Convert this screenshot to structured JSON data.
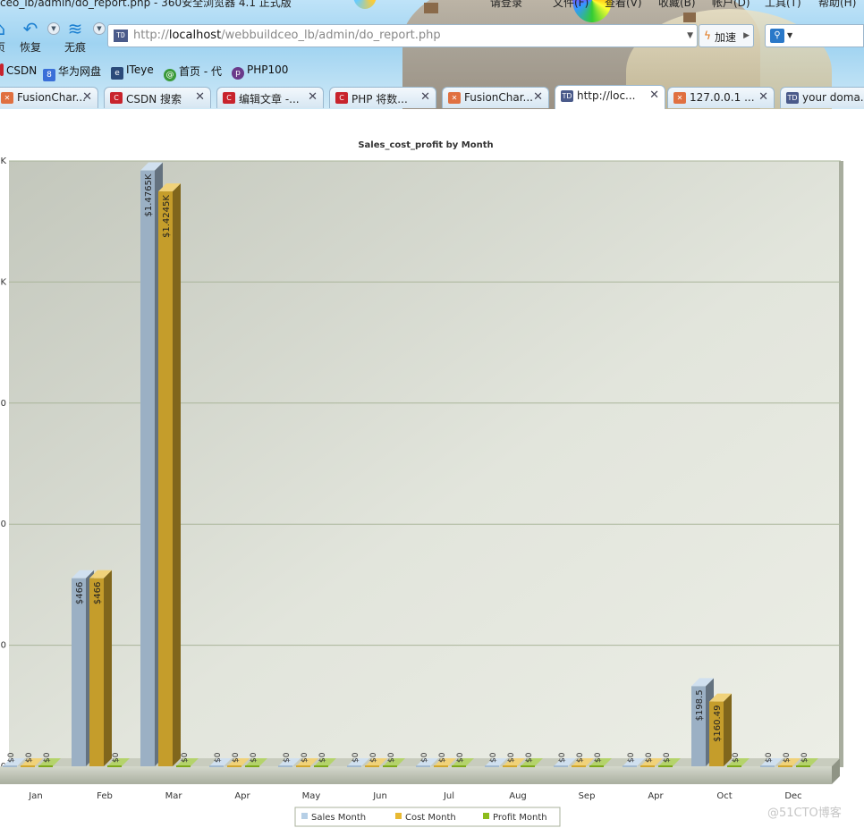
{
  "window": {
    "title_left": "ceo_lb/admin/do_report.php - 360安全浏览器 4.1 正式版",
    "menu": [
      "请登录",
      "文件(F)",
      "查看(V)",
      "收藏(B)",
      "帐户(D)",
      "工具(T)",
      "帮助(H)"
    ]
  },
  "toolbar": {
    "buttons": [
      {
        "icon": "home-icon",
        "label": "页"
      },
      {
        "icon": "restore-icon",
        "label": "恢复"
      },
      {
        "icon": "incognito-icon",
        "label": "无痕"
      }
    ]
  },
  "address": {
    "prefix": "http://",
    "host": "localhost",
    "path": "/webbuildceo_lb/admin/do_report.php",
    "site_icon": "TD",
    "accelerate_label": "加速"
  },
  "favorites": [
    {
      "label": "CSDN",
      "icon": "csdn-icon",
      "color": "#c8232c"
    },
    {
      "label": "华为网盘",
      "icon": "huawei-disk-icon",
      "color": "#3a6fd8"
    },
    {
      "label": "ITeye",
      "icon": "iteye-icon",
      "color": "#2a4a7a"
    },
    {
      "label": "首页 - 代",
      "icon": "site-icon",
      "color": "#3a9a3a"
    },
    {
      "label": "PHP100",
      "icon": "php100-icon",
      "color": "#6a3a8a"
    }
  ],
  "tabs": [
    {
      "label": "FusionChar...",
      "icon": "fusioncharts-icon",
      "color": "#e07040",
      "active": false
    },
    {
      "label": "CSDN 搜索",
      "icon": "csdn-icon",
      "color": "#c8232c",
      "active": false
    },
    {
      "label": "编辑文章 -...",
      "icon": "csdn-icon",
      "color": "#c8232c",
      "active": false
    },
    {
      "label": "PHP 将数...",
      "icon": "csdn-icon",
      "color": "#c8232c",
      "active": false
    },
    {
      "label": "FusionChar...",
      "icon": "fusioncharts-icon",
      "color": "#e07040",
      "active": false
    },
    {
      "label": "http://loc...",
      "icon": "td-icon",
      "color": "#4a5a8a",
      "active": true
    },
    {
      "label": "127.0.0.1 ...",
      "icon": "fusioncharts-icon",
      "color": "#e07040",
      "active": false
    },
    {
      "label": "your doma...",
      "icon": "td-icon",
      "color": "#4a5a8a",
      "active": false
    }
  ],
  "chart_data": {
    "type": "bar",
    "title": "Sales_cost_profit by Month",
    "categories": [
      "Jan",
      "Feb",
      "Mar",
      "Apr",
      "May",
      "Jun",
      "Jul",
      "Aug",
      "Sep",
      "Apr",
      "Oct",
      "Dec"
    ],
    "series": [
      {
        "name": "Sales Month",
        "color": "#b6cfe6",
        "values": [
          0,
          466,
          1476.5,
          0,
          0,
          0,
          0,
          0,
          0,
          0,
          198.5,
          0
        ],
        "labels": [
          "$0",
          "$466",
          "$1.4765K",
          "$0",
          "$0",
          "$0",
          "$0",
          "$0",
          "$0",
          "$0",
          "$198.5",
          "$0"
        ]
      },
      {
        "name": "Cost Month",
        "color": "#e8b932",
        "values": [
          0,
          466,
          1424.5,
          0,
          0,
          0,
          0,
          0,
          0,
          0,
          160.49,
          0
        ],
        "labels": [
          "$0",
          "$466",
          "$1.4245K",
          "$0",
          "$0",
          "$0",
          "$0",
          "$0",
          "$0",
          "$0",
          "$160.49",
          "$0"
        ]
      },
      {
        "name": "Profit Month",
        "color": "#8cbc1c",
        "values": [
          0,
          0,
          0,
          0,
          0,
          0,
          0,
          0,
          0,
          0,
          0,
          0
        ],
        "labels": [
          "$0",
          "$0",
          "$0",
          "$0",
          "$0",
          "$0",
          "$0",
          "$0",
          "$0",
          "$0",
          "$0",
          "$0"
        ]
      }
    ],
    "ylim": [
      0,
      1500
    ],
    "yticks": [
      0,
      300,
      600,
      900,
      1200,
      1500
    ],
    "ytick_labels": [
      "0",
      "0",
      "0",
      "0",
      "K",
      "K"
    ],
    "grid": true,
    "legend": "bottom-center"
  },
  "watermark": "@51CTO博客"
}
